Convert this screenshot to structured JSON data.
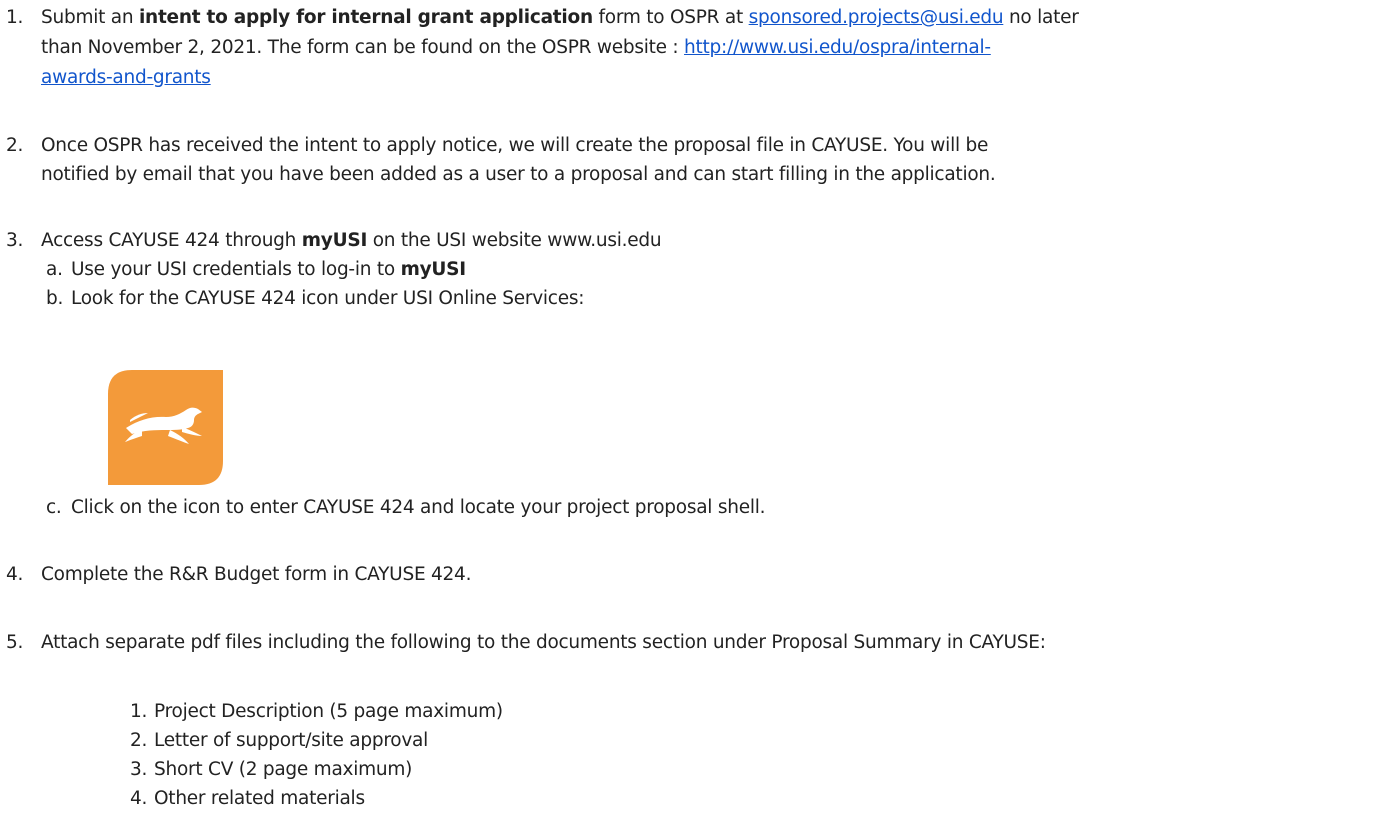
{
  "items": {
    "i1": {
      "num": "1.",
      "pre": "Submit an ",
      "bold": "intent to apply for internal grant application",
      "mid": " form to OSPR at ",
      "email": "sponsored.projects@usi.edu",
      "post": " no later",
      "line2_pre": "than November 2, 2021.  The form can be found on the OSPR website : ",
      "link_part1": "http://www.usi.edu/ospra/internal-",
      "link_part2": "awards-and-grants"
    },
    "i2": {
      "num": "2.",
      "line1": "Once OSPR has received the intent to apply notice, we will create the proposal file in CAYUSE. You will be",
      "line2": "notified by email that you have been added as a user to a proposal and can start filling in the application."
    },
    "i3": {
      "num": "3.",
      "pre": "Access CAYUSE 424 through ",
      "bold": "myUSI",
      "post": " on the USI website www.usi.edu",
      "a": {
        "label": "a.",
        "pre": "Use your USI credentials to log-in to ",
        "bold": "myUSI"
      },
      "b": {
        "label": "b.",
        "text": "Look for the CAYUSE 424 icon under USI Online Services:"
      },
      "c": {
        "label": "c.",
        "text": "Click on the icon to enter CAYUSE 424 and locate your project proposal shell."
      }
    },
    "i4": {
      "num": "4.",
      "text": "Complete the R&R Budget form in CAYUSE 424."
    },
    "i5": {
      "num": "5.",
      "text": "Attach separate pdf files including the following to the documents section under Proposal Summary in CAYUSE:",
      "sub": [
        {
          "num": "1.",
          "text": "Project Description (5 page maximum)"
        },
        {
          "num": "2.",
          "text": "Letter of support/site approval"
        },
        {
          "num": "3.",
          "text": "Short CV (2 page maximum)"
        },
        {
          "num": "4.",
          "text": "Other related materials"
        }
      ]
    }
  },
  "icon": {
    "name": "cayuse-horse-icon",
    "bg": "#f39a3a",
    "fg": "#ffffff"
  },
  "colors": {
    "link": "#1155cc",
    "text": "#222222"
  }
}
